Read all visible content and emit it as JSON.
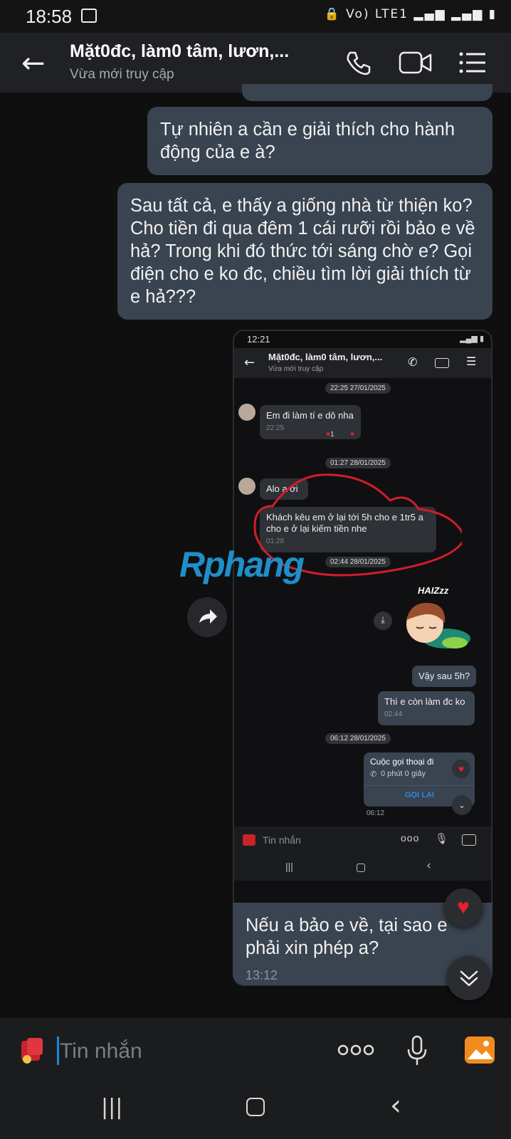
{
  "status_bar": {
    "time": "18:58",
    "right_icons": "🔒 Vo) LTE1 ▂▄▆ ▂▄▆ ▮"
  },
  "header": {
    "back_icon": "←",
    "title": "Mặt0đc, làm0 tâm, lươn,...",
    "subtitle": "Vừa mới truy cập",
    "call_icon": "✆",
    "video_icon": "▭",
    "menu_icon": "☰"
  },
  "messages": {
    "m1": "Tự nhiên a cần e giải thích cho hành động của e à?",
    "m2": "Sau tất cả, e thấy a giống nhà từ thiện ko? Cho tiền đi qua đêm 1 cái rưỡi rồi bảo e về hả? Trong khi đó thức tới sáng chờ e? Gọi điện cho e ko đc, chiều tìm lời giải thích từ e hả???"
  },
  "screenshot": {
    "status_time": "12:21",
    "title": "Mặt0đc, làm0 tâm, lươn,...",
    "subtitle": "Vừa mới truy cập",
    "date1": "22:25 27/01/2025",
    "msg_a": "Em đi làm tí e dô nha",
    "msg_a_time": "22:25",
    "reaction_count": "1",
    "date2": "01:27 28/01/2025",
    "msg_b": "Alo a ơi",
    "msg_c": "Khách kêu em ở lại tới 5h cho e 1tr5 a cho e ở lại kiếm tiền nhe",
    "msg_c_time": "01:28",
    "date3": "02:44 28/01/2025",
    "sticker_text": "HAIZzz",
    "msg_d": "Vậy sau 5h?",
    "msg_e": "Thì e còn làm đc ko",
    "msg_e_time": "02:44",
    "date4": "06:12 28/01/2025",
    "call_title": "Cuộc gọi thoại đi",
    "call_duration": "0 phút 0 giây",
    "call_again": "GỌI LẠI",
    "call_time": "06:12",
    "input_placeholder": "Tin nhắn"
  },
  "watermark": "Rphang",
  "reply": {
    "text": "Nếu a bảo e về, tại sao e phải xin phép a?",
    "time": "13:12"
  },
  "input": {
    "placeholder": "Tin nhắn"
  },
  "colors": {
    "bubble_out": "#3a4350",
    "background": "#0f0f10",
    "accent": "#1f87d6",
    "heart": "#e3222e"
  }
}
